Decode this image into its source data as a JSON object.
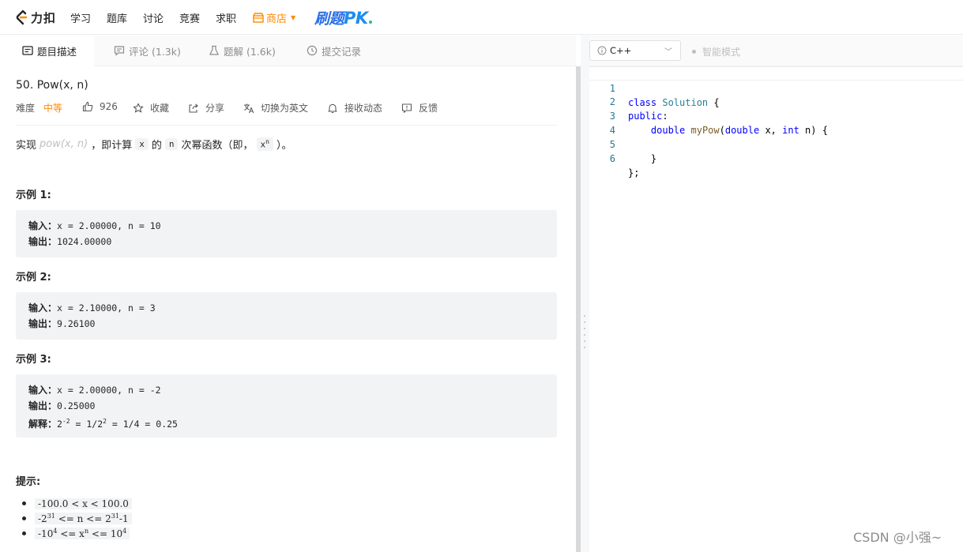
{
  "nav": {
    "logo_text": "力扣",
    "items": [
      "学习",
      "题库",
      "讨论",
      "竞赛",
      "求职"
    ],
    "store_label": "商店",
    "pk_prefix": "刷题",
    "pk_word": "PK"
  },
  "tabs": {
    "description": "题目描述",
    "comments": "评论 (1.3k)",
    "solutions": "题解 (1.6k)",
    "submissions": "提交记录"
  },
  "problem": {
    "title": "50. Pow(x, n)",
    "difficulty_label": "难度",
    "difficulty": "中等",
    "likes": "926",
    "favorite": "收藏",
    "share": "分享",
    "switch_lang": "切换为英文",
    "notify": "接收动态",
    "feedback": "反馈",
    "desc_prefix": "实现",
    "desc_func": "pow(x, n)",
    "desc_mid": "，即计算",
    "desc_x": "x",
    "desc_of": "的",
    "desc_n": "n",
    "desc_suffix": "次幂函数（即，",
    "desc_xn_base": "x",
    "desc_xn_exp": "n",
    "desc_end": "）。"
  },
  "examples": [
    {
      "heading": "示例 1:",
      "input_label": "输入：",
      "input": "x = 2.00000, n = 10",
      "output_label": "输出：",
      "output": "1024.00000"
    },
    {
      "heading": "示例 2:",
      "input_label": "输入：",
      "input": "x = 2.10000, n = 3",
      "output_label": "输出：",
      "output": "9.26100"
    },
    {
      "heading": "示例 3:",
      "input_label": "输入：",
      "input": "x = 2.00000, n = -2",
      "output_label": "输出：",
      "output": "0.25000",
      "explain_label": "解释：",
      "explain_base": "2",
      "explain_exp": "-2",
      "explain_mid": " = 1/2",
      "explain_exp2": "2",
      "explain_end": " = 1/4 = 0.25"
    }
  ],
  "hints": {
    "heading": "提示:",
    "h1": "-100.0 < x < 100.0",
    "h2_a": "-2",
    "h2_exp1": "31",
    "h2_b": " <= n <= 2",
    "h2_exp2": "31",
    "h2_c": "-1",
    "h3_a": "-10",
    "h3_exp1": "4",
    "h3_b": " <= x",
    "h3_exp2": "n",
    "h3_c": " <= 10",
    "h3_exp3": "4"
  },
  "editor": {
    "language": "C++",
    "smart_mode": "智能模式",
    "lines": [
      {
        "no": "1",
        "text": "class Solution {"
      },
      {
        "no": "2",
        "text": "public:"
      },
      {
        "no": "3",
        "text": "    double myPow(double x, int n) {"
      },
      {
        "no": "4",
        "text": ""
      },
      {
        "no": "5",
        "text": "    }"
      },
      {
        "no": "6",
        "text": "};"
      }
    ]
  },
  "watermark": "CSDN @小强~",
  "colors": {
    "accent_orange": "#ff8a00",
    "pk_blue": "#1c8cf2",
    "line_number": "#237893",
    "keyword": "#0000ff",
    "type": "#267f99",
    "function": "#795e26"
  }
}
